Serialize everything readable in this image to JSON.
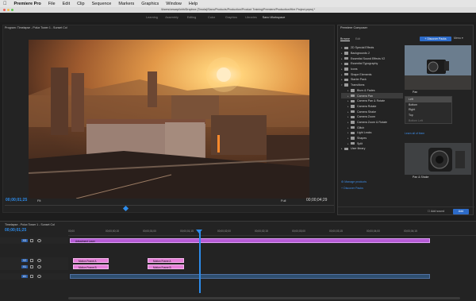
{
  "menubar": {
    "app": "Premiere Pro",
    "items": [
      "File",
      "Edit",
      "Clip",
      "Sequence",
      "Markers",
      "Graphics",
      "Window",
      "Help"
    ]
  },
  "path": "/Users/cesarpi/ohh/Dropbox (Tovola)/Sano/Products/Production/Product Training/Premiere/Production/Hire Project.prproj *",
  "workspaces": [
    "Learning",
    "Assembly",
    "Editing",
    "Color",
    "Graphics",
    "Libraries",
    "Sano Workspace"
  ],
  "active_workspace": "Sano Workspace",
  "program": {
    "title": "Program: Timelapse - Polux Tower 1 - Sunset Col",
    "timecode": "00;00;01;25",
    "fit": "Fit",
    "quality": "Full",
    "duration": "00;00;04;29"
  },
  "composer": {
    "title": "Premiere Composer",
    "tabs": [
      "Browse",
      "Edit"
    ],
    "discover_button": "Discover Packs",
    "menu": "Menu",
    "folders": [
      {
        "label": "2D Special Effects",
        "level": 0
      },
      {
        "label": "Backgrounds 2",
        "level": 0
      },
      {
        "label": "Essential Sound Effects V2",
        "level": 0
      },
      {
        "label": "Essential Typography",
        "level": 0
      },
      {
        "label": "Icons",
        "level": 0
      },
      {
        "label": "Shape Elements",
        "level": 0
      },
      {
        "label": "Starter Pack",
        "level": 0
      },
      {
        "label": "Transitions",
        "level": 0,
        "open": true
      },
      {
        "label": "Blurs & Fades",
        "level": 1
      },
      {
        "label": "Camera Pan",
        "level": 1,
        "selected": true
      },
      {
        "label": "Camera Pan & Rotate",
        "level": 1
      },
      {
        "label": "Camera Rotate",
        "level": 1
      },
      {
        "label": "Camera Shake",
        "level": 1
      },
      {
        "label": "Camera Zoom",
        "level": 1
      },
      {
        "label": "Camera Zoom & Rotate",
        "level": 1
      },
      {
        "label": "Glitch",
        "level": 1
      },
      {
        "label": "Light Leaks",
        "level": 1
      },
      {
        "label": "Shapes",
        "level": 1
      },
      {
        "label": "Split",
        "level": 1
      },
      {
        "label": "User library",
        "level": 0
      }
    ],
    "manage": "Manage products",
    "discover_link": "Discover Packs",
    "preset1": "Pan",
    "dropdown": [
      "Left",
      "Bottom",
      "Right",
      "Top",
      "Bottom Left"
    ],
    "dropdown_selected": "Left",
    "learn_more": "Learn all of them",
    "preset2": "Pan & Shake",
    "add_sound": "Add sound",
    "add": "Add"
  },
  "timeline": {
    "title": "Timelapse - Polux Tower 1 - Sunset Col",
    "timecode": "00;00;01;25",
    "ruler": [
      "00;00",
      "00;00;00;15",
      "00;00;01;00",
      "00;00;01;15",
      "00;00;02;00",
      "00;00;02;15",
      "00;00;03;00",
      "00;00;03;15",
      "00;00;04;00",
      "00;00;04;15"
    ],
    "tracks": [
      {
        "name": "V3"
      },
      {
        "name": "V2"
      },
      {
        "name": "V1"
      },
      {
        "name": "A1"
      }
    ],
    "clips": {
      "adjustment": "Adjustment Layer",
      "pink1": "Motion Frame A",
      "pink2": "Motion Frame A",
      "blue1": "Motion Frame B",
      "blue2": "Motion Frame B"
    }
  }
}
